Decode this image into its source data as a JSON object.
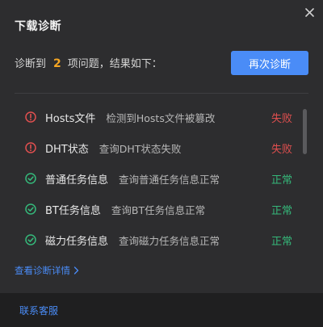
{
  "dialog": {
    "title": "下载诊断",
    "close_icon": "close-icon"
  },
  "summary": {
    "prefix": "诊断到",
    "count": "2",
    "suffix": "项问题，结果如下："
  },
  "retry_button": {
    "label": "再次诊断"
  },
  "items": [
    {
      "name": "Hosts文件",
      "desc": "检测到Hosts文件被篡改",
      "status": "失败",
      "state": "fail",
      "icon": "error-icon"
    },
    {
      "name": "DHT状态",
      "desc": "查询DHT状态失败",
      "status": "失败",
      "state": "fail",
      "icon": "error-icon"
    },
    {
      "name": "普通任务信息",
      "desc": "查询普通任务信息正常",
      "status": "正常",
      "state": "ok",
      "icon": "check-icon"
    },
    {
      "name": "BT任务信息",
      "desc": "查询BT任务信息正常",
      "status": "正常",
      "state": "ok",
      "icon": "check-icon"
    },
    {
      "name": "磁力任务信息",
      "desc": "查询磁力任务信息正常",
      "status": "正常",
      "state": "ok",
      "icon": "check-icon"
    }
  ],
  "details_link": {
    "label": "查看诊断详情"
  },
  "footer": {
    "contact_label": "联系客服"
  },
  "colors": {
    "accent": "#4a8cf7",
    "fail": "#e04f4f",
    "ok": "#35b87a",
    "count": "#f5a623"
  }
}
